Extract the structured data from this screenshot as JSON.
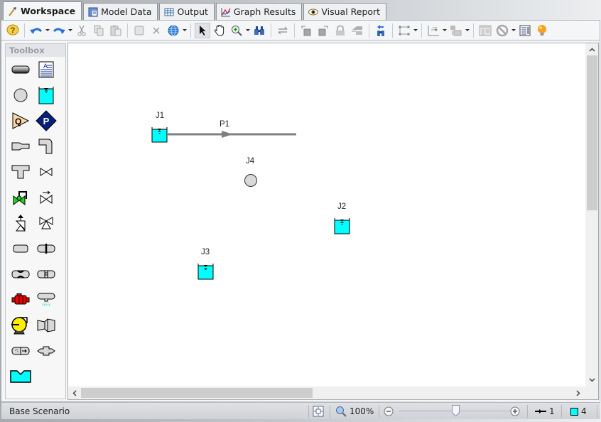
{
  "tabs": [
    {
      "label": "Workspace",
      "icon": "workspace-icon",
      "active": true
    },
    {
      "label": "Model Data",
      "icon": "model-data-icon",
      "active": false
    },
    {
      "label": "Output",
      "icon": "output-table-icon",
      "active": false
    },
    {
      "label": "Graph Results",
      "icon": "graph-results-icon",
      "active": false
    },
    {
      "label": "Visual Report",
      "icon": "visual-report-eye-icon",
      "active": false
    }
  ],
  "toolbar": {
    "buttons": [
      "help",
      "undo",
      "redo",
      "cut",
      "copy",
      "paste",
      "group",
      "delete",
      "browser",
      "select-arrow",
      "pan-hand",
      "zoom-in",
      "find-binoculars",
      "reverse-direction",
      "send-back",
      "bring-front",
      "lock",
      "annotation-layer",
      "find-in-model",
      "pipe-routing",
      "align",
      "distribute",
      "properties-panel",
      "disable",
      "checklist",
      "tips-lightbulb"
    ]
  },
  "toolbox": {
    "title": "Toolbox",
    "tools": [
      "pipe",
      "annotation",
      "branch",
      "reservoir",
      "assigned-flow",
      "assigned-pressure",
      "dead-end-reducer",
      "bend",
      "tee",
      "valve",
      "control-valve",
      "check-valve",
      "relief-valve",
      "three-way-valve",
      "general-component",
      "orifice",
      "venturi",
      "screen",
      "pump",
      "spray-discharge",
      "heat-exchanger",
      "area-change",
      "filter",
      "compressor",
      "volume-balance"
    ]
  },
  "canvas": {
    "pipes": [
      {
        "label": "P1"
      }
    ],
    "junctions": [
      {
        "label": "J1",
        "type": "reservoir"
      },
      {
        "label": "J2",
        "type": "reservoir"
      },
      {
        "label": "J3",
        "type": "reservoir"
      },
      {
        "label": "J4",
        "type": "branch"
      }
    ]
  },
  "status": {
    "scenario": "Base Scenario",
    "zoom_level": "100%",
    "zoom_fraction": 0.5,
    "pipe_count": "1",
    "junction_count": "4"
  },
  "colors": {
    "reservoir_fill": "#00ffff",
    "pipe": "#808080",
    "branch_fill": "#d9d9d9"
  }
}
